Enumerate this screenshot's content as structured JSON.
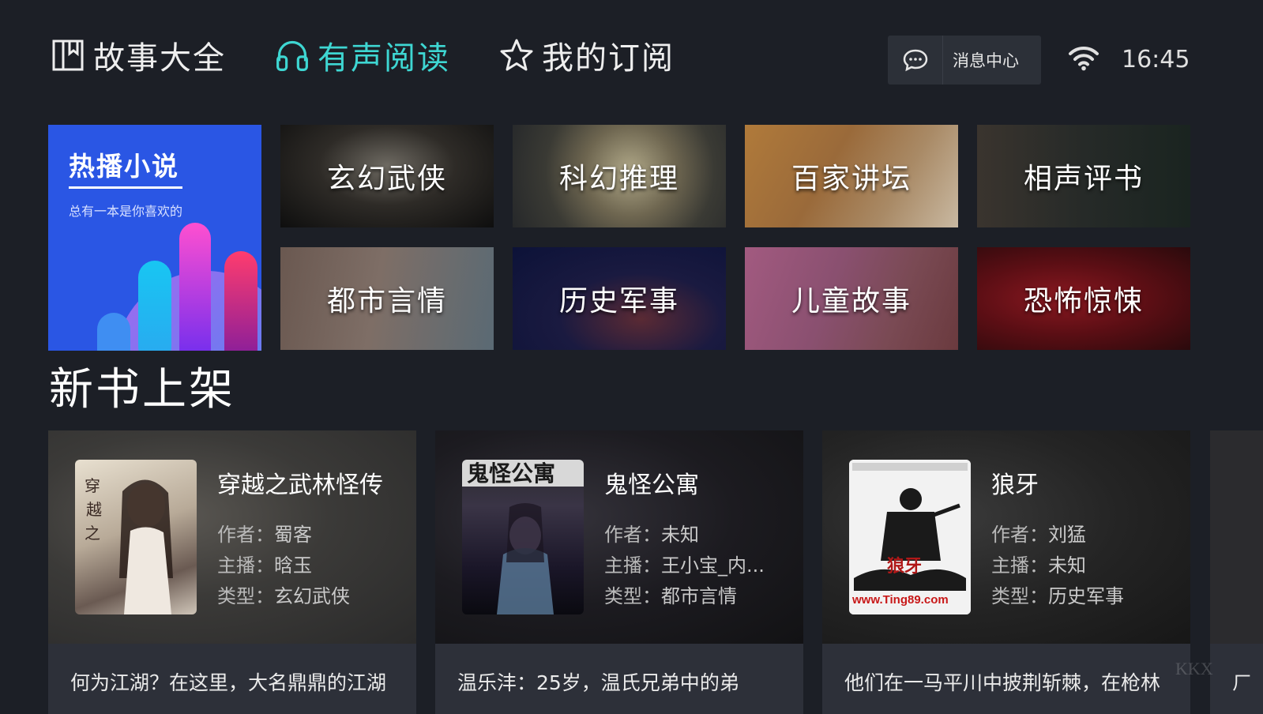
{
  "nav": {
    "tabs": [
      {
        "label": "故事大全",
        "icon": "book-icon",
        "active": false
      },
      {
        "label": "有声阅读",
        "icon": "headphones-icon",
        "active": true
      },
      {
        "label": "我的订阅",
        "icon": "star-icon",
        "active": false
      }
    ],
    "message_center": "消息中心",
    "clock": "16:45",
    "accent_color": "#3ed6d2"
  },
  "hero": {
    "title": "热播小说",
    "subtitle": "总有一本是你喜欢的",
    "bg_color": "#2a56e4"
  },
  "categories": [
    {
      "label": "玄幻武侠"
    },
    {
      "label": "科幻推理"
    },
    {
      "label": "百家讲坛"
    },
    {
      "label": "相声评书"
    },
    {
      "label": "都市言情"
    },
    {
      "label": "历史军事"
    },
    {
      "label": "儿童故事"
    },
    {
      "label": "恐怖惊悚"
    }
  ],
  "new_books": {
    "section_title": "新书上架",
    "author_key": "作者：",
    "narrator_key": "主播：",
    "type_key": "类型：",
    "books": [
      {
        "title": "穿越之武林怪传",
        "author": "蜀客",
        "narrator": "晗玉",
        "type": "玄幻武侠",
        "desc": "何为江湖？在这里，大名鼎鼎的江湖",
        "cover_text": "穿越之武林怪传"
      },
      {
        "title": "鬼怪公寓",
        "author": "未知",
        "narrator": "王小宝_内...",
        "type": "都市言情",
        "desc": "温乐沣：25岁，温氏兄弟中的弟",
        "cover_text": "鬼怪公寓"
      },
      {
        "title": "狼牙",
        "author": "刘猛",
        "narrator": "未知",
        "type": "历史军事",
        "desc": "他们在一马平川中披荆斩棘，在枪林",
        "cover_text": "www.Ting89.com"
      }
    ],
    "peek_text": "ㄏ"
  }
}
